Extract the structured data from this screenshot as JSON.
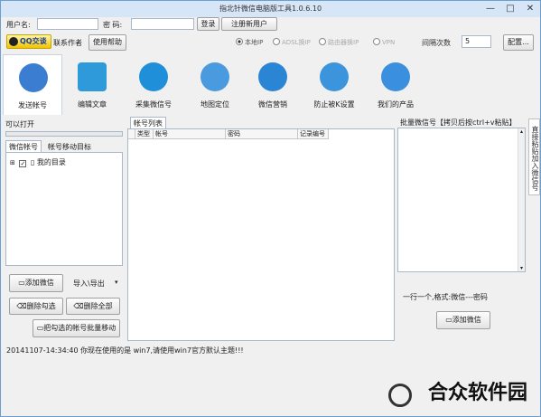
{
  "window": {
    "title": "指北针微信电脑版工具1.0.6.10"
  },
  "login": {
    "username_label": "用户名:",
    "password_label": "密  码:",
    "login_button": "登录",
    "register_button": "注册新用户"
  },
  "row2": {
    "qq_button": "QQ交谈",
    "contact_author": "联系作者",
    "help_button": "使用帮助",
    "radios": [
      "本地IP",
      "ADSL换IP",
      "路由器换IP",
      "VPN"
    ],
    "interval_label": "间隔次数",
    "interval_value": "5",
    "config_button": "配置..."
  },
  "toolbar": {
    "tools": [
      "发送帐号",
      "编辑文章",
      "采集微信号",
      "地图定位",
      "微信营销",
      "防止被K设置",
      "我们的产品"
    ]
  },
  "left": {
    "can_open_label": "可以打开",
    "tabs": [
      "微信帐号",
      "帐号移动目标"
    ],
    "tree_item": "我的目录",
    "add_wechat_button": "添加微信",
    "import_export_button": "导入\\导出",
    "delete_checked_button": "删除勾选",
    "delete_all_button": "删除全部",
    "move_checked_button": "把勾选的帐号批量移动"
  },
  "middle": {
    "tab_label": "帐号列表",
    "columns": [
      "类型",
      "帐号",
      "密码",
      "记录编号"
    ]
  },
  "right": {
    "header": "批量微信号【拷贝后按ctrl+v粘贴】",
    "hint": "一行一个,格式:微信---密码",
    "add_button": "添加微信",
    "vertical_tab": "直接粘贴加入微信号"
  },
  "status": {
    "text": "20141107-14:34:40  你现在使用的是 win7,请使用win7官方默认主题!!!"
  },
  "watermark": {
    "text": "合众软件园"
  },
  "colors": {
    "accent": "#2e7bd6",
    "title_bg": "#d6e6f7",
    "qq_yellow": "#f2c200"
  }
}
